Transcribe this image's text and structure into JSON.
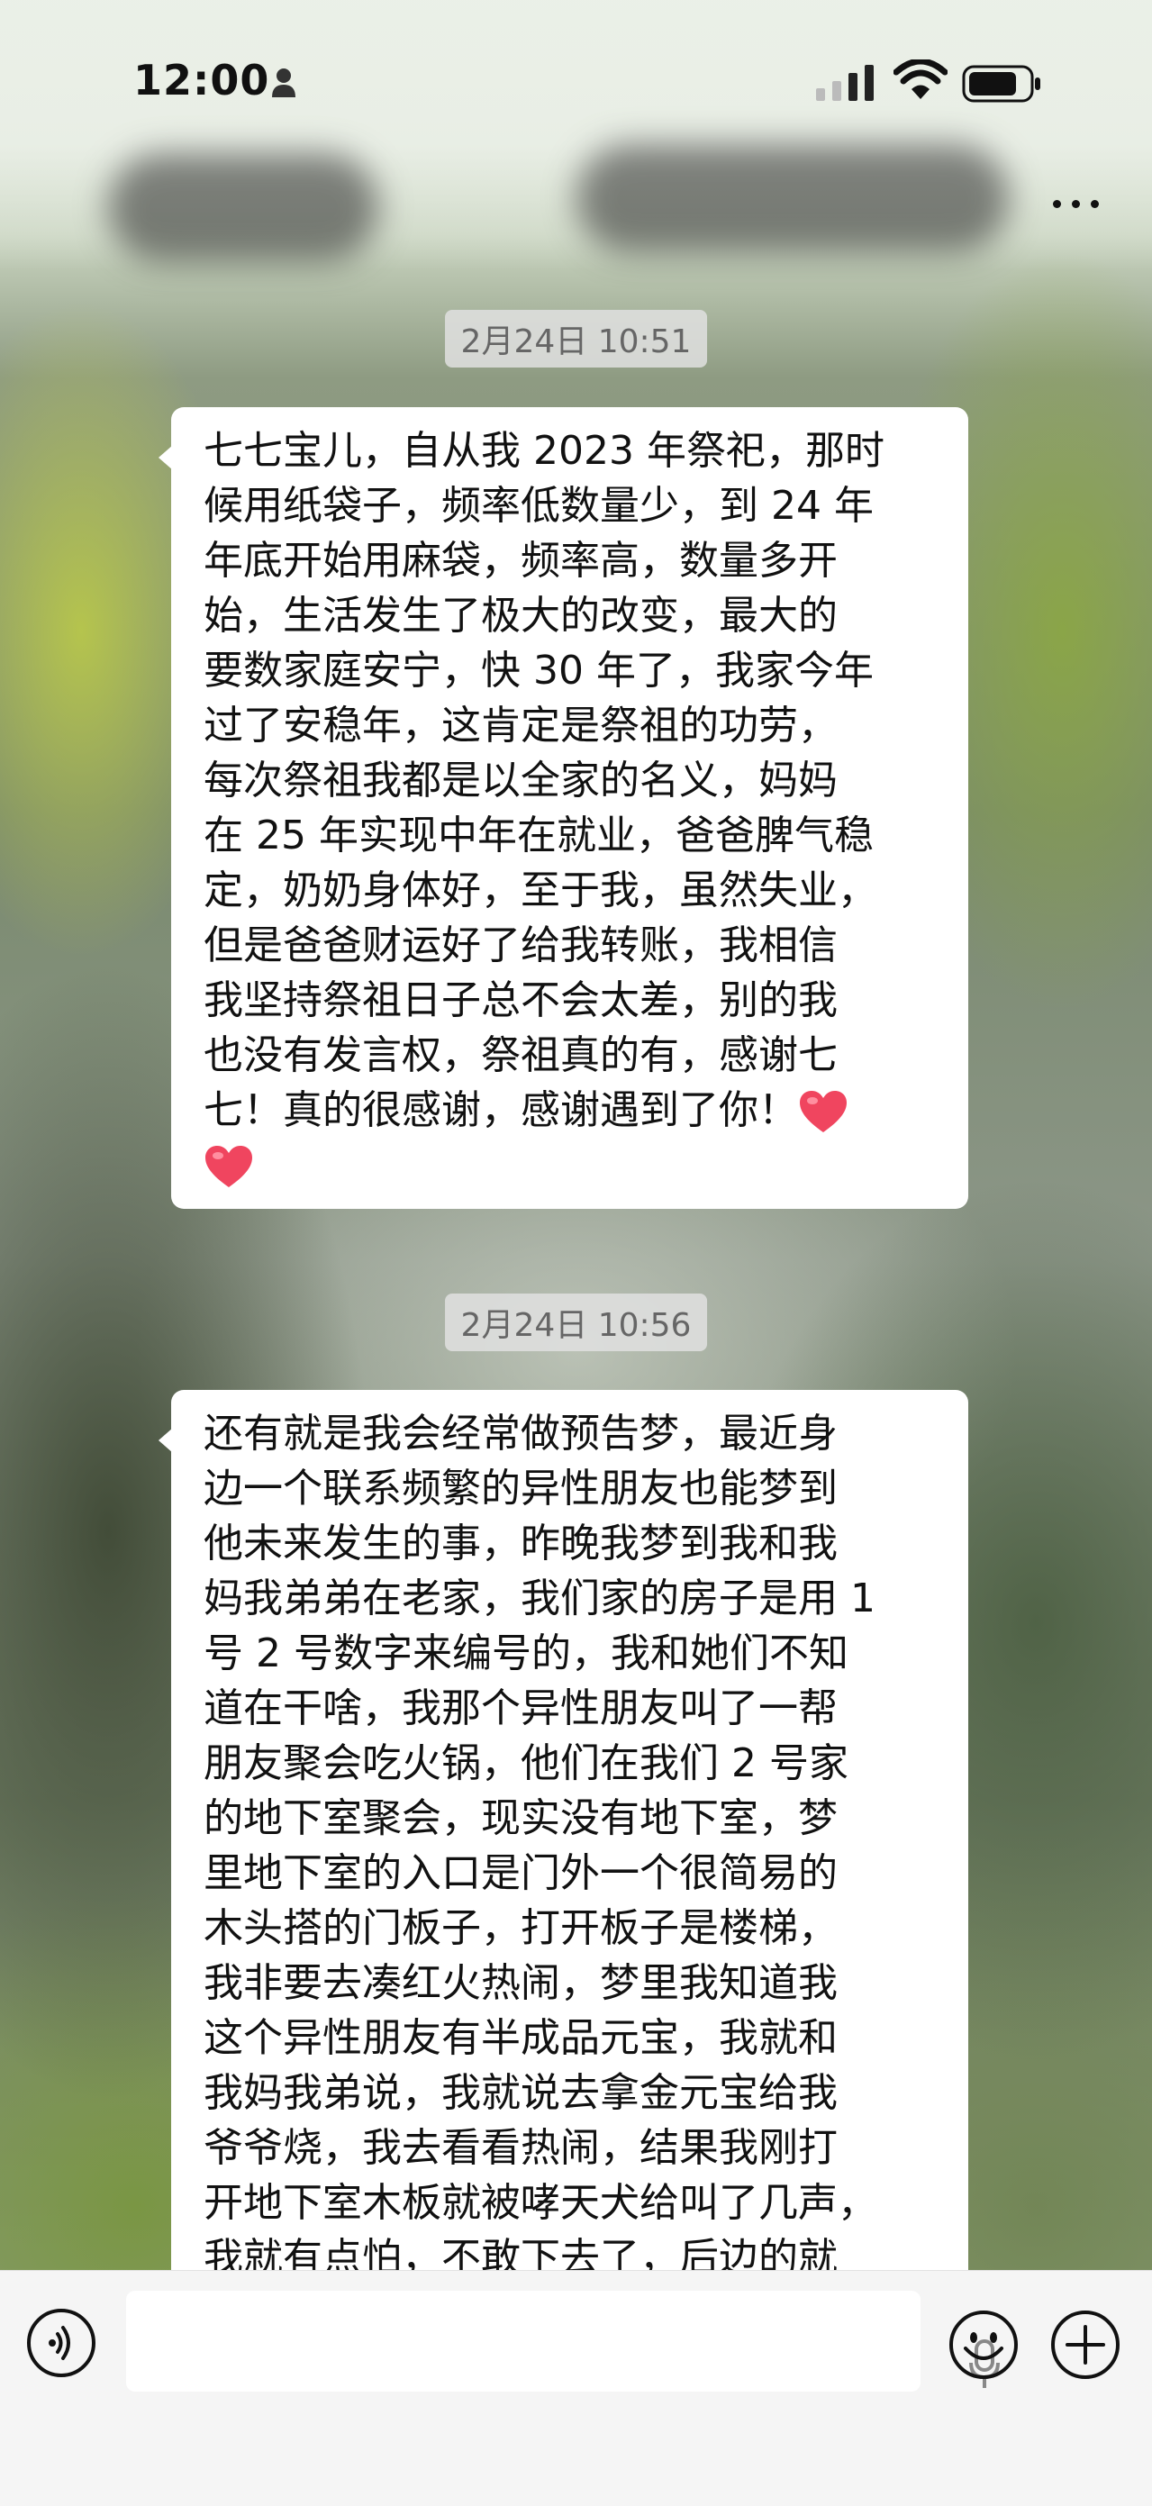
{
  "status_bar": {
    "time": "12:00"
  },
  "header": {
    "more_icon": "more-horizontal-icon"
  },
  "messages": [
    {
      "timestamp": "2月24日 10:51",
      "lines": [
        "七七宝儿，自从我 2023 年祭祀，那时",
        "候用纸袋子，频率低数量少，到 24 年",
        "年底开始用麻袋，频率高，数量多开",
        "始，生活发生了极大的改变，最大的",
        "要数家庭安宁，快 30 年了，我家今年",
        "过了安稳年，这肯定是祭祖的功劳，",
        "每次祭祖我都是以全家的名义，妈妈",
        "在 25 年实现中年在就业，爸爸脾气稳",
        "定，奶奶身体好，至于我，虽然失业，",
        "但是爸爸财运好了给我转账，我相信",
        "我坚持祭祖日子总不会太差，别的我",
        "也没有发言权，祭祖真的有，感谢七",
        "七！真的很感谢，感谢遇到了你！"
      ],
      "emoji": "red-heart"
    },
    {
      "timestamp": "2月24日 10:56",
      "lines": [
        "还有就是我会经常做预告梦，最近身",
        "边一个联系频繁的异性朋友也能梦到",
        "他未来发生的事，昨晚我梦到我和我",
        "妈我弟弟在老家，我们家的房子是用 1",
        "号 2 号数字来编号的，我和她们不知",
        "道在干啥，我那个异性朋友叫了一帮",
        "朋友聚会吃火锅，他们在我们 2 号家",
        "的地下室聚会，现实没有地下室，梦",
        "里地下室的入口是门外一个很简易的",
        "木头搭的门板子，打开板子是楼梯，",
        "我非要去凑红火热闹，梦里我知道我",
        "这个异性朋友有半成品元宝，我就和",
        "我妈我弟说，我就说去拿金元宝给我",
        "爷爷烧，我去看看热闹，结果我刚打",
        "开地下室木板就被哮天犬给叫了几声，",
        "我就有点怕，不敢下去了，后边的就"
      ]
    }
  ],
  "input_bar": {
    "voice_icon": "voice-icon",
    "mic_icon": "microphone-icon",
    "emoji_icon": "emoji-icon",
    "plus_icon": "plus-icon"
  }
}
